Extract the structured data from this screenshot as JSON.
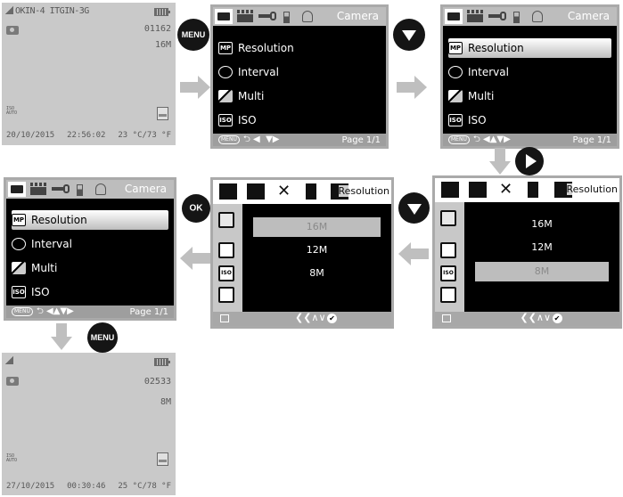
{
  "live_view_1": {
    "status": "OKIN-4 ITGIN-3G",
    "count": "01162",
    "resolution": "16M",
    "iso_label": "ISO AUTO",
    "date": "20/10/2015",
    "time": "22:56:02",
    "temperature": "23 °C/73 °F"
  },
  "live_view_2": {
    "count": "02533",
    "resolution": "8M",
    "iso_label": "ISO AUTO",
    "date": "27/10/2015",
    "time": "00:30:46",
    "temperature": "25 °C/78 °F"
  },
  "camera_menu": {
    "title": "Camera",
    "items": [
      "Resolution",
      "Interval",
      "Multi",
      "ISO"
    ],
    "item_icons": [
      "MP",
      "",
      "",
      "ISO"
    ],
    "menu_button": "MENU",
    "page": "Page  1/1"
  },
  "resolution_menu": {
    "title": "Resolution",
    "options": [
      "16M",
      "12M",
      "8M"
    ],
    "nav_glyphs": "❮❮∧∨",
    "ok_glyph": "✔"
  },
  "buttons": {
    "menu": "MENU",
    "ok": "OK"
  },
  "colors": {
    "screen_bg": "#000000",
    "live_bg": "#c9c9c9",
    "arrow": "#bfbfbf",
    "button": "#151515",
    "highlight": "#bdbdbd"
  }
}
